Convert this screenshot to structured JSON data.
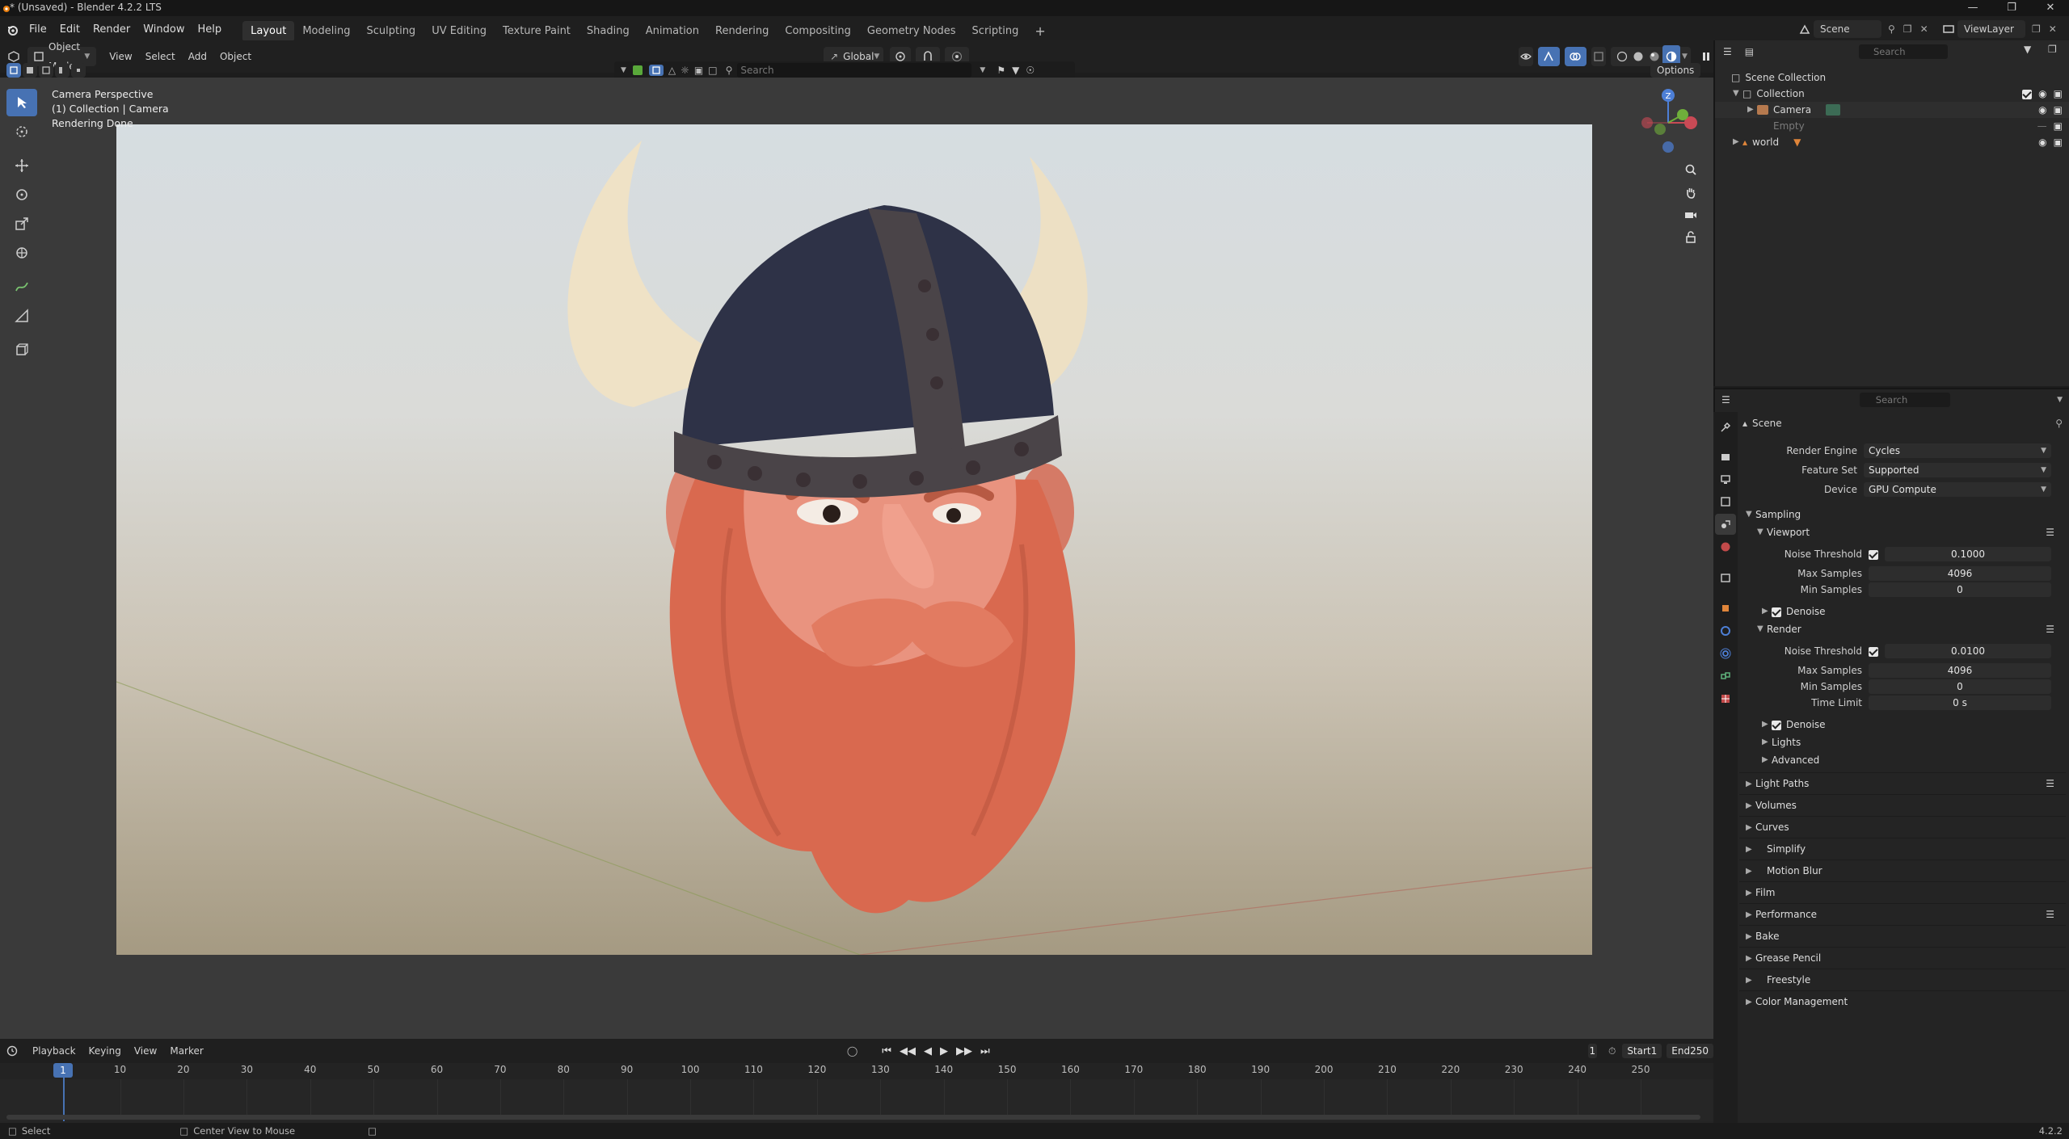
{
  "window": {
    "title": "* (Unsaved) - Blender 4.2.2 LTS"
  },
  "menu": [
    "File",
    "Edit",
    "Render",
    "Window",
    "Help"
  ],
  "workspaces": {
    "active": "Layout",
    "tabs": [
      "Layout",
      "Modeling",
      "Sculpting",
      "UV Editing",
      "Texture Paint",
      "Shading",
      "Animation",
      "Rendering",
      "Compositing",
      "Geometry Nodes",
      "Scripting"
    ]
  },
  "scene_field": "Scene",
  "viewlayer_field": "ViewLayer",
  "viewport_header": {
    "mode": "Object Mode",
    "menus": [
      "View",
      "Select",
      "Add",
      "Object"
    ],
    "orientation": "Global",
    "options": "Options",
    "search_placeholder": "Search"
  },
  "viewport_overlay": {
    "line1": "Camera Perspective",
    "line2": "(1) Collection | Camera",
    "line3": "Rendering Done"
  },
  "outliner": {
    "search_placeholder": "Search",
    "items": {
      "scene_collection": "Scene Collection",
      "collection": "Collection",
      "camera": "Camera",
      "empty": "Empty",
      "world": "world"
    }
  },
  "properties": {
    "search_placeholder": "Search",
    "context": "Scene",
    "render_engine_label": "Render Engine",
    "render_engine": "Cycles",
    "feature_set_label": "Feature Set",
    "feature_set": "Supported",
    "device_label": "Device",
    "device": "GPU Compute",
    "sampling": "Sampling",
    "viewport": "Viewport",
    "vp_noise_label": "Noise Threshold",
    "vp_noise": "0.1000",
    "vp_max_label": "Max Samples",
    "vp_max": "4096",
    "vp_min_label": "Min Samples",
    "vp_min": "0",
    "denoise": "Denoise",
    "render": "Render",
    "r_noise_label": "Noise Threshold",
    "r_noise": "0.0100",
    "r_max_label": "Max Samples",
    "r_max": "4096",
    "r_min_label": "Min Samples",
    "r_min": "0",
    "time_limit_label": "Time Limit",
    "time_limit": "0 s",
    "denoise2": "Denoise",
    "lights": "Lights",
    "advanced": "Advanced",
    "sections": [
      "Light Paths",
      "Volumes",
      "Curves",
      "Simplify",
      "Motion Blur",
      "Film",
      "Performance",
      "Bake",
      "Grease Pencil",
      "Freestyle",
      "Color Management"
    ]
  },
  "timeline": {
    "menus": [
      "Playback",
      "Keying",
      "View",
      "Marker"
    ],
    "current_frame": "1",
    "start_label": "Start",
    "start": "1",
    "end_label": "End",
    "end": "250",
    "playhead_label": "1",
    "ticks": [
      "10",
      "20",
      "30",
      "40",
      "50",
      "60",
      "70",
      "80",
      "90",
      "100",
      "110",
      "120",
      "130",
      "140",
      "150",
      "160",
      "170",
      "180",
      "190",
      "200",
      "210",
      "220",
      "230",
      "240",
      "250"
    ]
  },
  "statusbar": {
    "select": "Select",
    "center_view": "Center View to Mouse",
    "version": "4.2.2"
  },
  "colors": {
    "accent": "#4772b3",
    "ws_active": "#2f2f2f",
    "beard": "#d9694f",
    "helmet": "#2e3247",
    "horn": "#efe2c6"
  }
}
